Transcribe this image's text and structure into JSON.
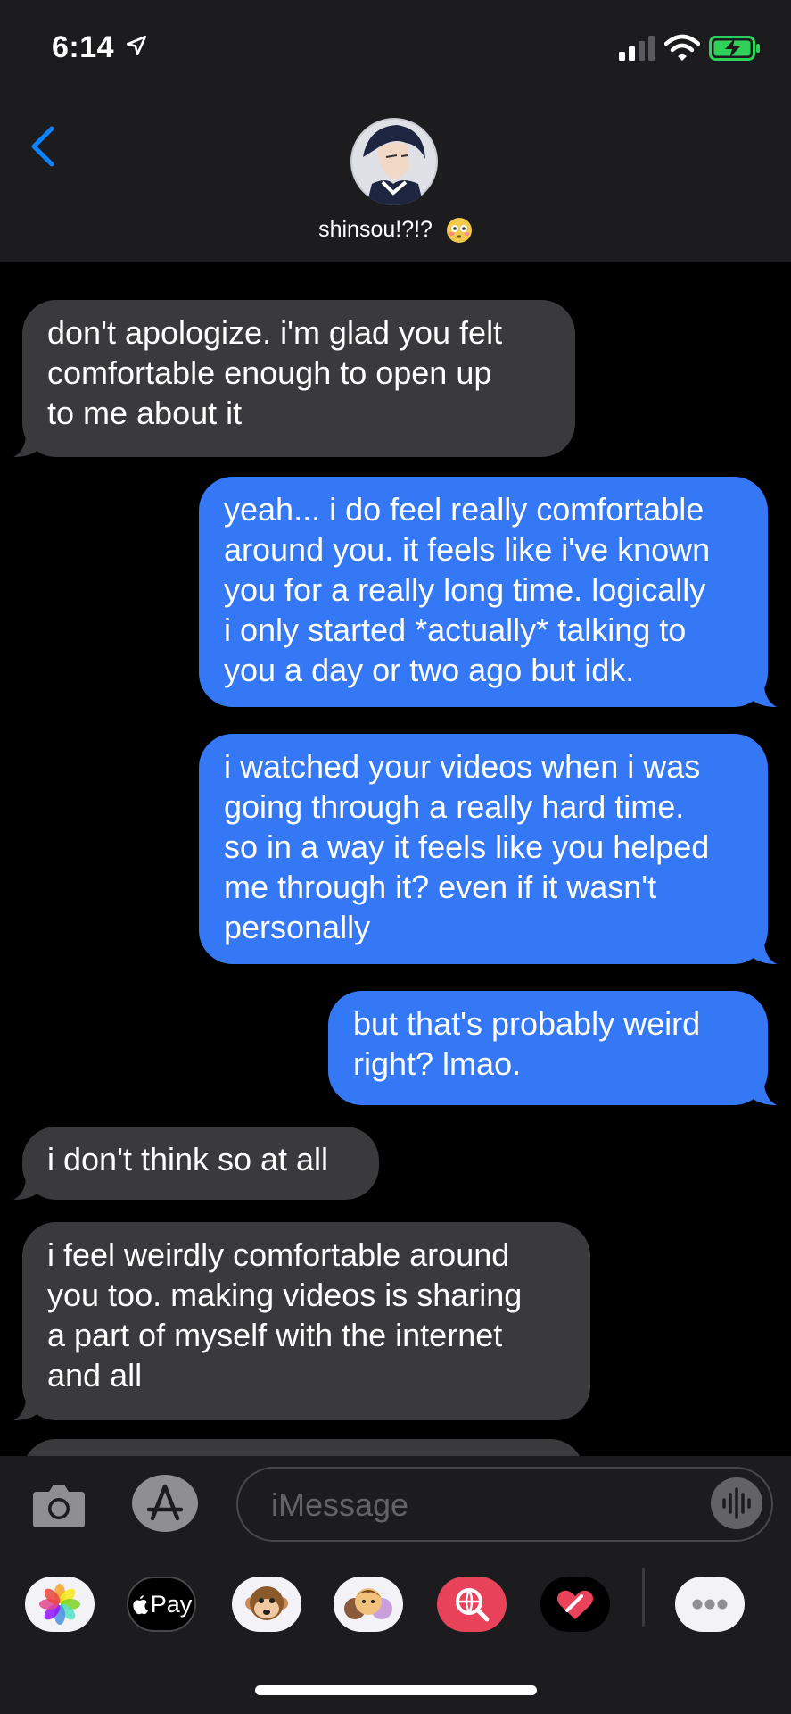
{
  "status_bar": {
    "time": "6:14",
    "icons": [
      "location-arrow-icon",
      "cellular-signal-icon",
      "wifi-icon",
      "battery-charging-icon"
    ]
  },
  "header": {
    "contact_name": "shinsou!?!?",
    "contact_emoji": "flushed-face-icon",
    "back_icon": "chevron-left-icon"
  },
  "messages": [
    {
      "direction": "received",
      "text": "don't apologize. i'm glad you felt\ncomfortable enough to open up\nto me about it"
    },
    {
      "direction": "sent",
      "text": "yeah... i do feel really comfortable\naround you. it feels like i've known\nyou for a really long time. logically\ni only started *actually* talking to\nyou a day or two ago but idk."
    },
    {
      "direction": "sent",
      "text": "i watched your videos when i was\ngoing through a really hard time.\nso in a way it feels like you helped\nme through it? even if it wasn't\npersonally"
    },
    {
      "direction": "sent",
      "text": "but that's probably weird\nright? lmao."
    },
    {
      "direction": "received",
      "text": "i don't think so at all"
    },
    {
      "direction": "received",
      "text": "i feel weirdly comfortable around\nyou too. making videos is sharing\na part of myself with the internet\nand all"
    }
  ],
  "compose": {
    "placeholder": "iMessage",
    "icons": [
      "camera-icon",
      "app-store-icon",
      "audio-waveform-icon"
    ]
  },
  "app_tray": [
    {
      "name": "photos-app-icon"
    },
    {
      "name": "apple-pay-app-icon",
      "label": "Pay"
    },
    {
      "name": "animoji-app-icon"
    },
    {
      "name": "memoji-stickers-app-icon"
    },
    {
      "name": "web-images-app-icon"
    },
    {
      "name": "digital-touch-app-icon"
    },
    {
      "name": "more-apps-icon"
    }
  ],
  "colors": {
    "sent_bubble": "#3478f6",
    "received_bubble": "#3a3a3c",
    "background": "#000000",
    "bar": "#1c1c1e",
    "accent": "#0a84ff",
    "battery": "#30d158"
  }
}
